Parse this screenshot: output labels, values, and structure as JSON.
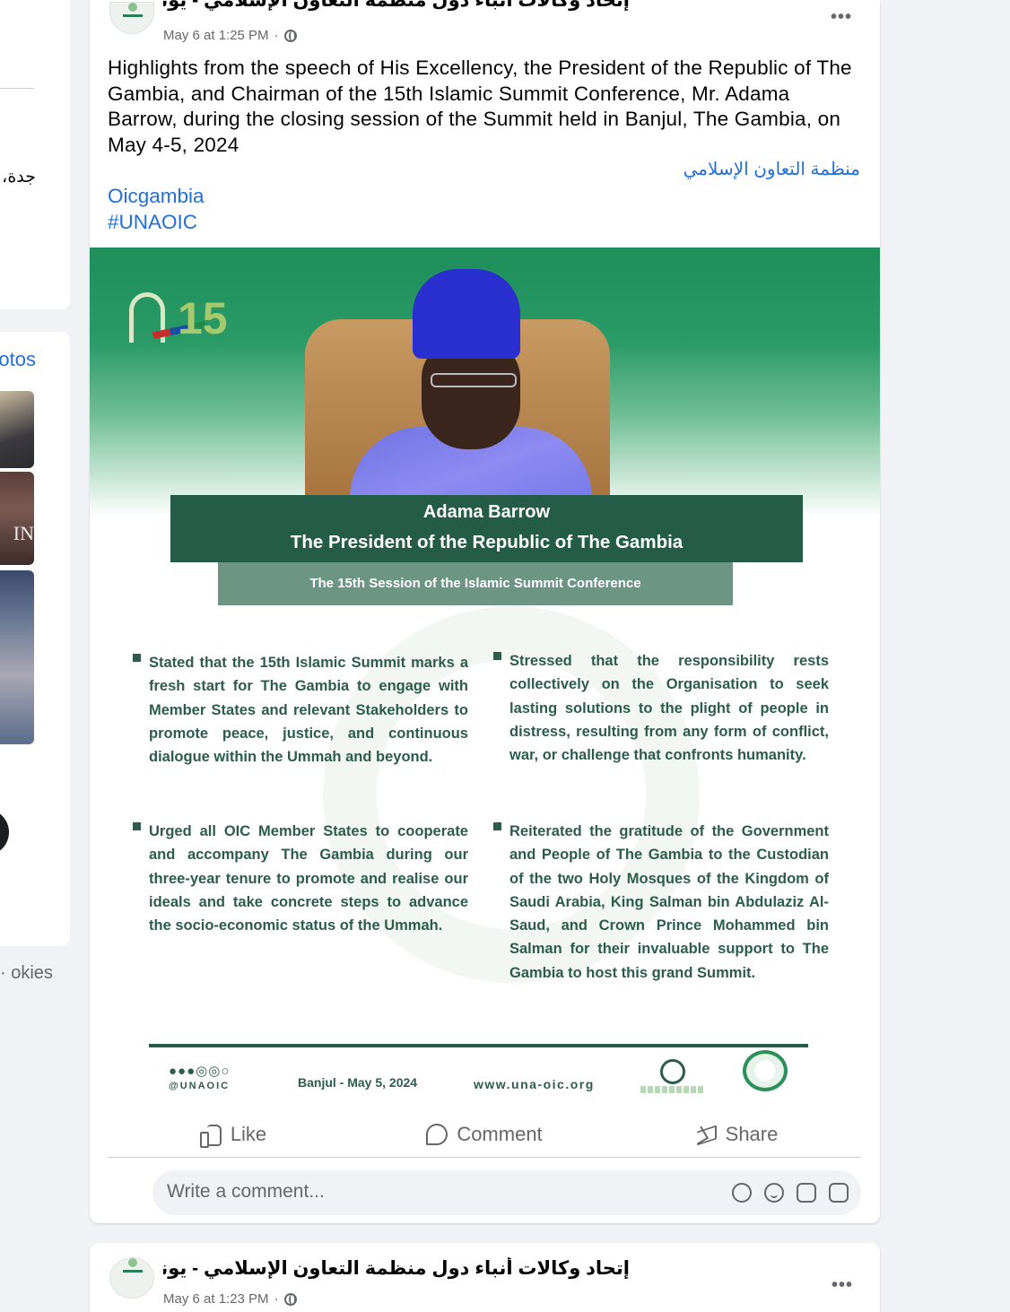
{
  "left_column": {
    "snippet_text": "جدة، ا",
    "photos_label": "otos",
    "thumb_text": "IN",
    "footer_text": "okies ·"
  },
  "post": {
    "page_name": "إتحاد وكالات أنباء دول منظمة التعاون الإسلامي - يونا",
    "timestamp": "May 6 at 1:25 PM",
    "more": "•••",
    "text": "Highlights from the speech of His Excellency, the President of the Republic of The Gambia, and Chairman of the 15th Islamic Summit Conference, Mr. Adama Barrow, during the closing session of the Summit held in Banjul, The Gambia, on May 4-5, 2024",
    "arabic_link": "منظمة التعاون الإسلامي",
    "hashtags": [
      "Oicgambia",
      "#UNAOIC"
    ],
    "image": {
      "logo_number": "15",
      "name": "Adama Barrow",
      "title": "The President of the Republic of The Gambia",
      "session": "The 15th Session of the Islamic Summit Conference",
      "bullets_left": [
        "Stated that the 15th Islamic Summit marks a fresh start for The Gambia to engage with Member States and relevant Stakeholders to promote peace, justice, and continuous dialogue within the Ummah and beyond.",
        "Urged all OIC Member States to cooperate and accompany The Gambia during our three-year tenure to promote and realise our ideals and take concrete steps to advance the socio-economic status of the Ummah."
      ],
      "bullets_right": [
        "Stressed that the responsibility rests collectively on the Organisation to seek lasting solutions to the plight of people in distress, resulting from any form of conflict, war, or challenge that confronts humanity.",
        "Reiterated the gratitude of the Government and People of The Gambia to the Custodian of the two Holy Mosques of the Kingdom of Saudi Arabia, King Salman bin Abdulaziz Al-Saud, and Crown Prince Mohammed bin Salman for their invaluable support to The Gambia to host this grand Summit."
      ],
      "footer_social": "●●●◎◎○",
      "footer_handle": "@UNAOIC",
      "footer_date": "Banjul - May 5, 2024",
      "footer_site": "www.una-oic.org"
    },
    "actions": {
      "like": "Like",
      "comment": "Comment",
      "share": "Share"
    },
    "comment_placeholder": "Write a comment..."
  },
  "next_post": {
    "page_name": "إتحاد وكالات أنباء دول منظمة التعاون الإسلامي - يونا",
    "timestamp": "May 6 at 1:23 PM",
    "more": "•••"
  },
  "colors": {
    "link_blue": "#216fdb",
    "banner_green": "#255c48",
    "session_green": "#6c9683",
    "text_green": "#2d5c4d"
  }
}
